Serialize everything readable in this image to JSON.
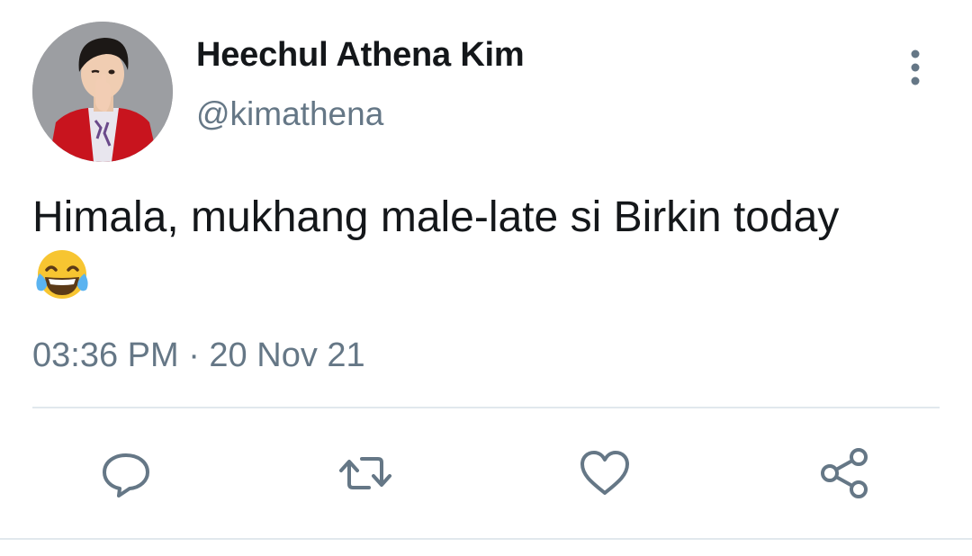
{
  "tweet": {
    "author": {
      "display_name": "Heechul Athena Kim",
      "handle": "@kimathena"
    },
    "text": "Himala, mukhang male-late si Birkin today",
    "emoji": "face-with-tears-of-joy",
    "timestamp": "03:36 PM · 20 Nov 21"
  },
  "actions": {
    "icons": [
      "reply-icon",
      "retweet-icon",
      "like-icon",
      "share-icon"
    ]
  },
  "colors": {
    "text_primary": "#14171a",
    "text_secondary": "#657786",
    "divider": "#e1e8ed",
    "icon": "#657786"
  }
}
